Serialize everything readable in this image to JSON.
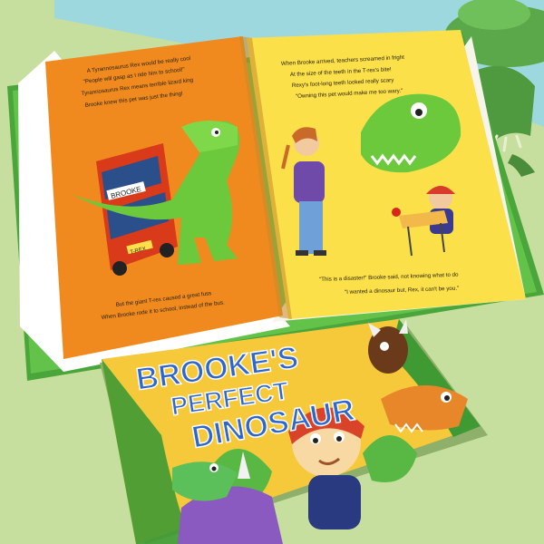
{
  "left_page": {
    "lines": [
      "A Tyrannosaurus Rex would be really cool",
      "\"People will gasp as I ride him to school!\"",
      "Tyrannosaurus Rex means terrible lizard king",
      "Brooke knew this pet was just the thing!"
    ],
    "caption": [
      "But the giant T-rex caused a great fuss",
      "When Brooke rode it to school, instead of the bus."
    ],
    "bus_sign": "BROOKE",
    "bus_plate": "T-REX"
  },
  "right_page": {
    "lines": [
      "When Brooke arrived, teachers screamed in fright",
      "At the size of the teeth in the T-rex's bite!",
      "Rexy's foot-long teeth looked really scary",
      "\"Owning this pet would make me too wary.\""
    ],
    "caption": [
      "\"This is a disaster!\" Brooke said, not knowing what to do",
      "\"I wanted a dinosaur but, Rex, it can't be you.\""
    ]
  },
  "cover": {
    "title_line1": "BROOKE'S",
    "title_line2": "PERFECT",
    "title_line3": "DINOSAUR"
  },
  "colors": {
    "background": "#c6df9e",
    "wall": "#9ed8df",
    "left_page": "#f08a1e",
    "right_page": "#fbe04a",
    "cover": "#f6c93a",
    "title": "#2f66c9",
    "dino_green": "#6cc93c",
    "bus_red": "#d93a1a"
  }
}
